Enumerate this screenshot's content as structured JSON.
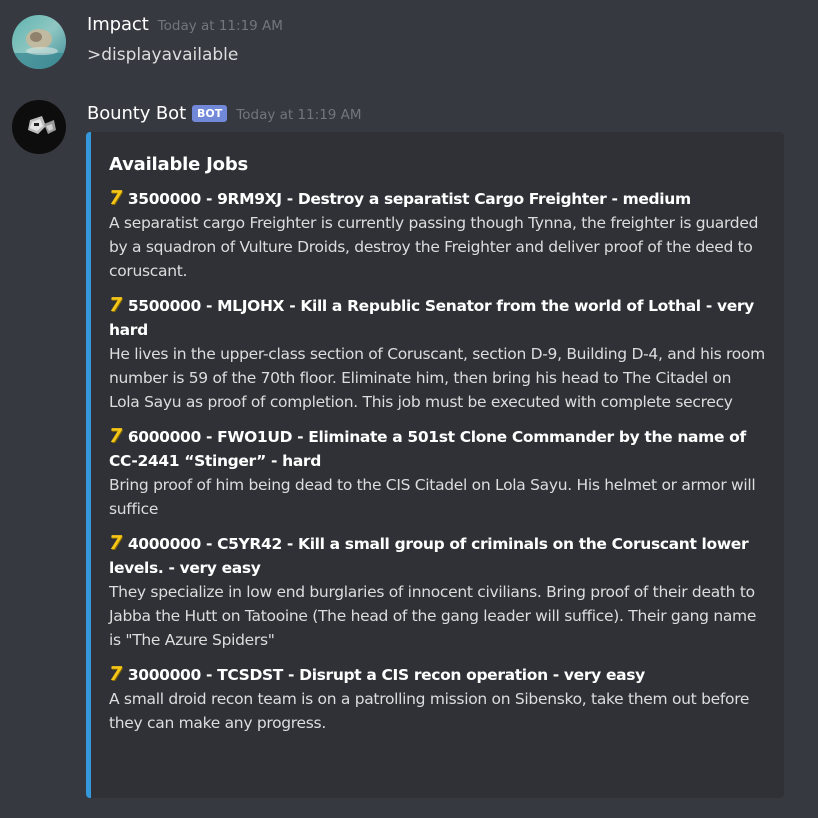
{
  "messages": [
    {
      "author": "Impact",
      "timestamp": "Today at 11:19 AM",
      "content": ">displayavailable"
    },
    {
      "author": "Bounty Bot",
      "badge": "BOT",
      "timestamp": "Today at 11:19 AM",
      "embed": {
        "title": "Available Jobs",
        "accent_color": "#3498db",
        "icon": "yellow-seven-icon",
        "jobs": [
          {
            "name": "3500000 - 9RM9XJ - Destroy a separatist Cargo Freighter - medium",
            "value": "A separatist cargo Freighter is currently passing though Tynna, the freighter is guarded by a squadron of Vulture Droids, destroy the Freighter and deliver proof of the deed to coruscant."
          },
          {
            "name": "5500000 - MLJOHX - Kill a Republic Senator from the world of Lothal - very hard",
            "value": "He lives in the upper-class section of Coruscant, section D-9, Building D-4, and his room number is 59 of the 70th floor. Eliminate him, then bring his head to The Citadel on Lola Sayu as proof of completion. This job must be executed with complete secrecy"
          },
          {
            "name": "6000000 - FWO1UD - Eliminate a 501st Clone Commander by the name of CC-2441 “Stinger” - hard",
            "value": "Bring proof of him being dead to the CIS Citadel on Lola Sayu. His helmet or armor will suffice"
          },
          {
            "name": "4000000 - C5YR42 - Kill a small group of criminals on the Coruscant lower levels. - very easy",
            "value": "They specialize in low end burglaries of innocent civilians. Bring proof of their death to Jabba the Hutt on Tatooine (The head of the gang leader will suffice). Their gang name is \"The Azure Spiders\""
          },
          {
            "name": "3000000 - TCSDST - Disrupt a CIS recon operation - very easy",
            "value": "A small droid recon team is on a patrolling mission on Sibensko, take them out before they can make any progress."
          }
        ]
      }
    }
  ]
}
